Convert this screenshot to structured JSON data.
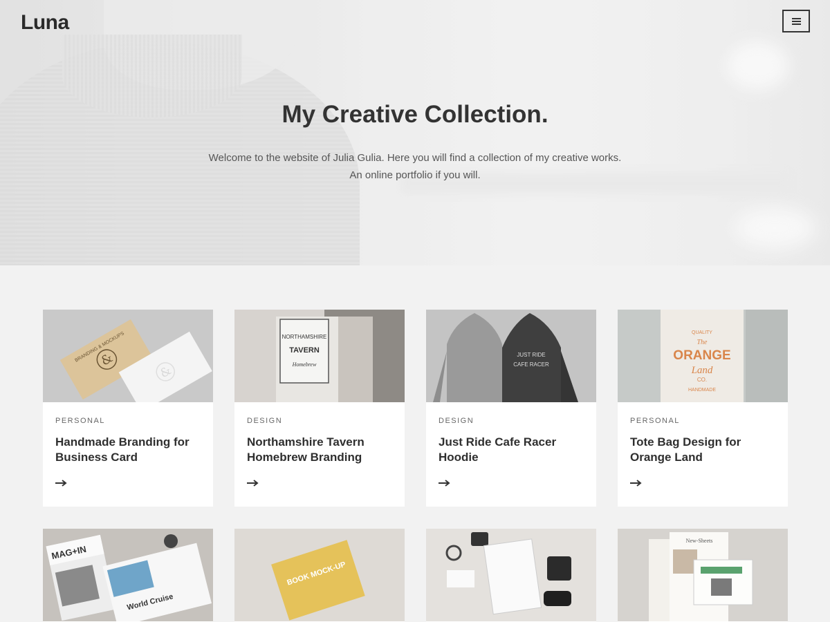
{
  "header": {
    "logo": "Luna",
    "menu_icon": "hamburger-icon"
  },
  "hero": {
    "title": "My Creative Collection.",
    "subtitle_line1": "Welcome to the website of Julia Gulia. Here you will find a collection of my creative works.",
    "subtitle_line2": "An online portfolio if you will."
  },
  "cards": [
    {
      "category": "PERSONAL",
      "title": "Handmade Branding for Business Card",
      "image": "business-card-mockup",
      "card_logo_text": "BRANDING & MOCKUPS"
    },
    {
      "category": "DESIGN",
      "title": "Northamshire Tavern Homebrew Branding",
      "image": "tavern-sign",
      "sign_line1": "NORTHAMSHIRE",
      "sign_line2": "TAVERN",
      "sign_line3": "Homebrew"
    },
    {
      "category": "DESIGN",
      "title": "Just Ride Cafe Racer Hoodie",
      "image": "hoodies",
      "hoodie_line1": "JUST RIDE",
      "hoodie_line2": "CAFE RACER"
    },
    {
      "category": "PERSONAL",
      "title": "Tote Bag Design for Orange Land",
      "image": "tote-bag",
      "tote_line1": "QUALITY",
      "tote_line2": "The",
      "tote_line3": "ORANGE",
      "tote_line4": "Land",
      "tote_line5": "CO.",
      "tote_line6": "HANDMADE"
    }
  ],
  "cards_row2": [
    {
      "image": "magazine-mockup",
      "mag_title": "MAG+IN",
      "mag_cover": "World Cruise"
    },
    {
      "image": "book-mockup",
      "book_text": "BOOK MOCK-UP"
    },
    {
      "image": "stationery-mockup"
    },
    {
      "image": "newspaper-mockup",
      "paper_title": "New-Sheets"
    }
  ],
  "colors": {
    "accent": "#333333",
    "card_bg": "#ffffff",
    "page_bg": "#f2f2f2",
    "orange": "#d9854a"
  }
}
